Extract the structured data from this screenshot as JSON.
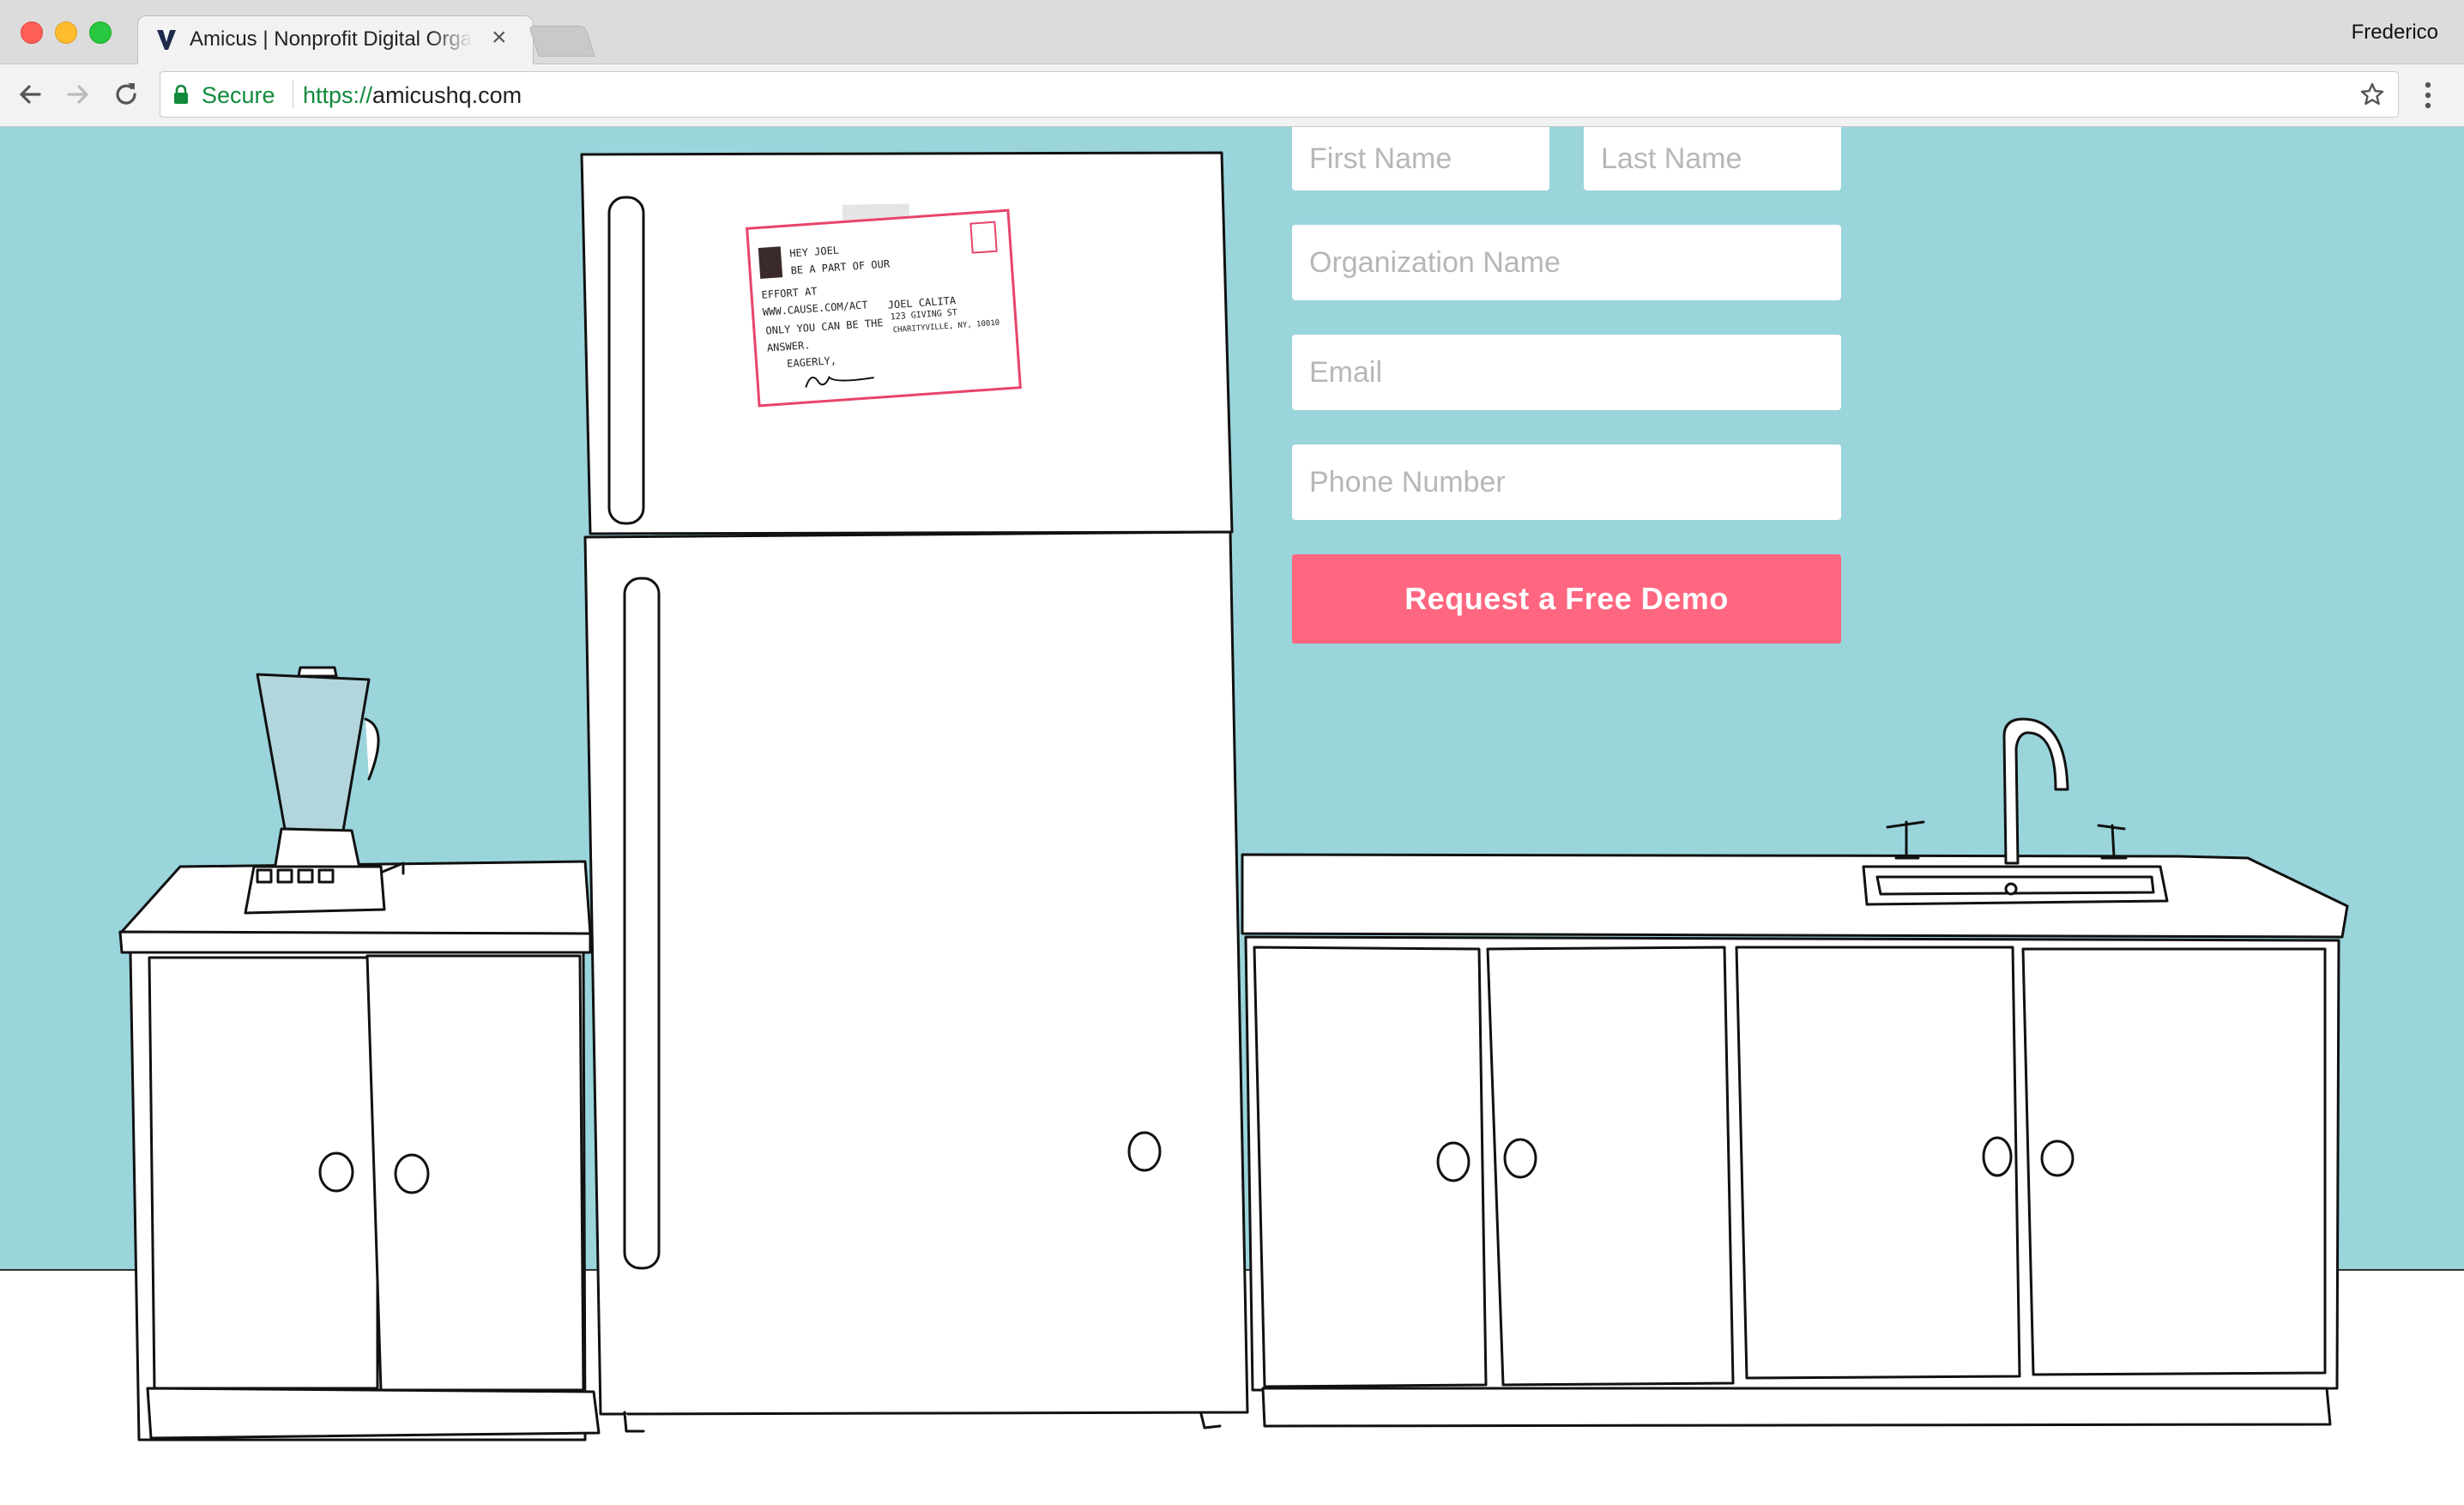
{
  "browser": {
    "tab_title": "Amicus | Nonprofit Digital Organizing",
    "tab_close": "×",
    "profile_name": "Frederico",
    "secure_label": "Secure",
    "url_scheme": "https://",
    "url_host": "amicushq.com"
  },
  "form": {
    "first_name_placeholder": "First Name",
    "last_name_placeholder": "Last Name",
    "organization_placeholder": "Organization Name",
    "email_placeholder": "Email",
    "phone_placeholder": "Phone Number",
    "submit_label": "Request a Free Demo",
    "submit_color": "#ff6680"
  },
  "postcard": {
    "line1": "Hey Joel",
    "line2": "Be a part of our",
    "line3": "effort at",
    "line4": "www.cause.com/act",
    "line5": "Only you can be the",
    "line6": "answer.",
    "line7": "Eagerly,",
    "address_name": "Joel Calita",
    "address_street": "123 Giving St",
    "address_city": "Charityville, NY, 10010"
  },
  "colors": {
    "wall": "#9ad5dc",
    "accent": "#ff6680"
  }
}
